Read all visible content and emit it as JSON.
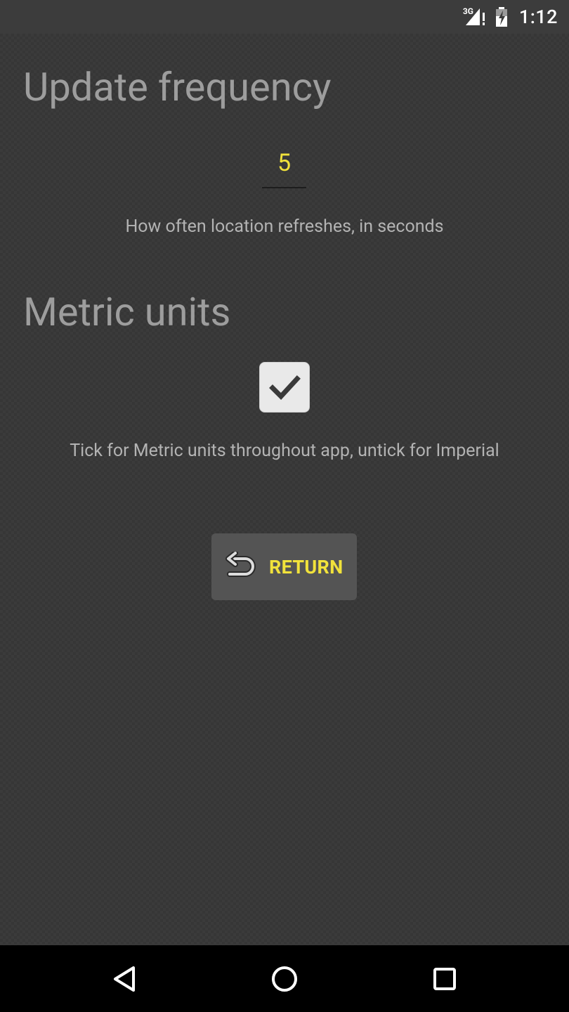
{
  "status_bar": {
    "network": "3G",
    "time": "1:12",
    "icons": [
      "signal-icon",
      "battery-icon"
    ]
  },
  "settings": {
    "update_frequency": {
      "title": "Update frequency",
      "value": "5",
      "help": "How often location refreshes, in seconds"
    },
    "metric_units": {
      "title": "Metric units",
      "checked": true,
      "help": "Tick for Metric units throughout app, untick for Imperial"
    }
  },
  "return_button": {
    "label": "RETURN",
    "icon": "undo-arrow-icon"
  },
  "nav_bar": {
    "buttons": [
      "back-icon",
      "home-icon",
      "recents-icon"
    ]
  },
  "colors": {
    "accent": "#f1e23b",
    "background": "#363636",
    "title": "#9d9d9d",
    "help_text": "#b3b3b3"
  }
}
